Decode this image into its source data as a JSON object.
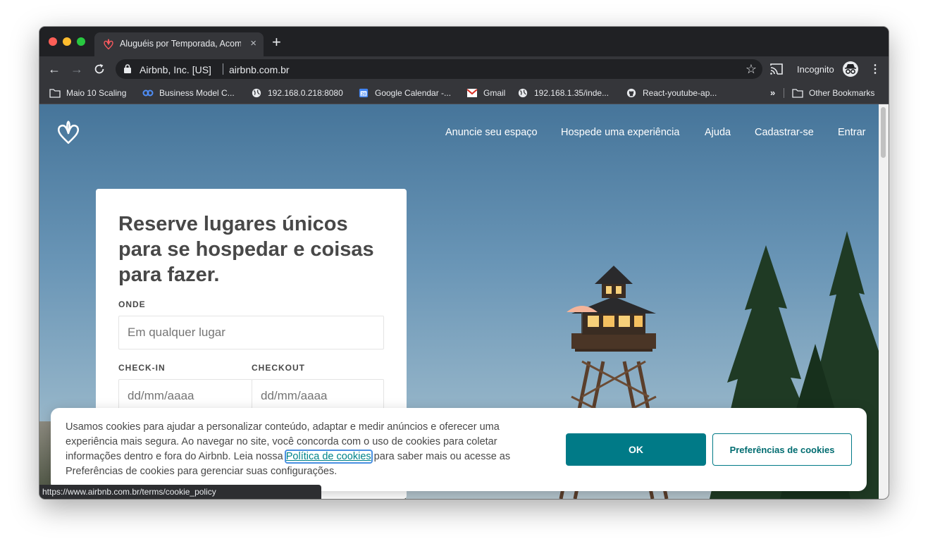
{
  "browser": {
    "tab_title": "Aluguéis por Temporada, Acom",
    "tab_close": "×",
    "new_tab": "+",
    "site_owner": "Airbnb, Inc. [US]",
    "url": "airbnb.com.br",
    "profile_label": "Incognito",
    "bookmarks": [
      {
        "label": "Maio 10 Scaling",
        "icon": "folder-icon"
      },
      {
        "label": "Business Model C...",
        "icon": "link-icon"
      },
      {
        "label": "192.168.0.218:8080",
        "icon": "globe-icon"
      },
      {
        "label": "Google Calendar -...",
        "icon": "calendar-icon",
        "badge": "28"
      },
      {
        "label": "Gmail",
        "icon": "gmail-icon"
      },
      {
        "label": "192.168.1.35/inde...",
        "icon": "globe-icon"
      },
      {
        "label": "React-youtube-ap...",
        "icon": "github-icon"
      }
    ],
    "overflow_chevron": "»",
    "other_bookmarks": "Other Bookmarks",
    "status_url": "https://www.airbnb.com.br/terms/cookie_policy"
  },
  "header": {
    "nav": [
      "Anuncie seu espaço",
      "Hospede uma experiência",
      "Ajuda",
      "Cadastrar-se",
      "Entrar"
    ]
  },
  "search_card": {
    "headline": "Reserve lugares únicos para se hospedar e coisas para fazer.",
    "where_label": "ONDE",
    "where_placeholder": "Em qualquer lugar",
    "checkin_label": "CHECK-IN",
    "checkout_label": "CHECKOUT",
    "checkin_placeholder": "dd/mm/aaaa",
    "checkout_placeholder": "dd/mm/aaaa"
  },
  "cookie_banner": {
    "text_before": "Usamos cookies para ajudar a personalizar conteúdo, adaptar e medir anúncios e oferecer uma experiência mais segura. Ao navegar no site, você concorda com o uso de cookies para coletar informações dentro e fora do Airbnb. Leia nossa ",
    "link": "Política de cookies",
    "text_after": " para saber mais ou acesse as Preferências de cookies para gerenciar suas configurações.",
    "ok_button": "OK",
    "prefs_button": "Preferências de cookies"
  },
  "colors": {
    "brand_teal": "#007a87",
    "airbnb_rausch": "#ff5a5f"
  }
}
